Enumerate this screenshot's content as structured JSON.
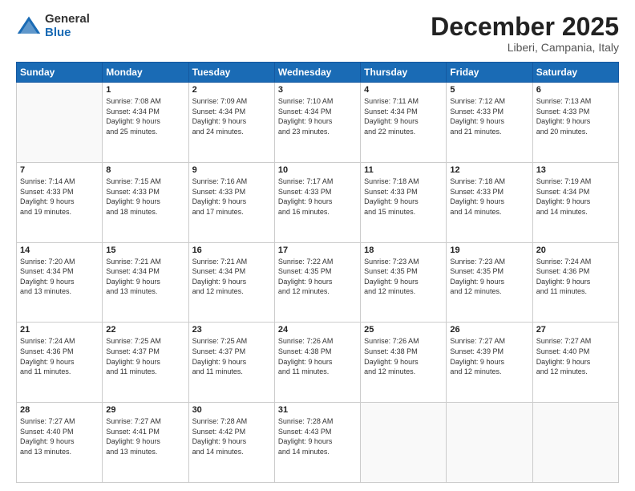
{
  "logo": {
    "general": "General",
    "blue": "Blue"
  },
  "title": "December 2025",
  "location": "Liberi, Campania, Italy",
  "weekdays": [
    "Sunday",
    "Monday",
    "Tuesday",
    "Wednesday",
    "Thursday",
    "Friday",
    "Saturday"
  ],
  "weeks": [
    [
      {
        "day": "",
        "info": ""
      },
      {
        "day": "1",
        "info": "Sunrise: 7:08 AM\nSunset: 4:34 PM\nDaylight: 9 hours\nand 25 minutes."
      },
      {
        "day": "2",
        "info": "Sunrise: 7:09 AM\nSunset: 4:34 PM\nDaylight: 9 hours\nand 24 minutes."
      },
      {
        "day": "3",
        "info": "Sunrise: 7:10 AM\nSunset: 4:34 PM\nDaylight: 9 hours\nand 23 minutes."
      },
      {
        "day": "4",
        "info": "Sunrise: 7:11 AM\nSunset: 4:34 PM\nDaylight: 9 hours\nand 22 minutes."
      },
      {
        "day": "5",
        "info": "Sunrise: 7:12 AM\nSunset: 4:33 PM\nDaylight: 9 hours\nand 21 minutes."
      },
      {
        "day": "6",
        "info": "Sunrise: 7:13 AM\nSunset: 4:33 PM\nDaylight: 9 hours\nand 20 minutes."
      }
    ],
    [
      {
        "day": "7",
        "info": "Sunrise: 7:14 AM\nSunset: 4:33 PM\nDaylight: 9 hours\nand 19 minutes."
      },
      {
        "day": "8",
        "info": "Sunrise: 7:15 AM\nSunset: 4:33 PM\nDaylight: 9 hours\nand 18 minutes."
      },
      {
        "day": "9",
        "info": "Sunrise: 7:16 AM\nSunset: 4:33 PM\nDaylight: 9 hours\nand 17 minutes."
      },
      {
        "day": "10",
        "info": "Sunrise: 7:17 AM\nSunset: 4:33 PM\nDaylight: 9 hours\nand 16 minutes."
      },
      {
        "day": "11",
        "info": "Sunrise: 7:18 AM\nSunset: 4:33 PM\nDaylight: 9 hours\nand 15 minutes."
      },
      {
        "day": "12",
        "info": "Sunrise: 7:18 AM\nSunset: 4:33 PM\nDaylight: 9 hours\nand 14 minutes."
      },
      {
        "day": "13",
        "info": "Sunrise: 7:19 AM\nSunset: 4:34 PM\nDaylight: 9 hours\nand 14 minutes."
      }
    ],
    [
      {
        "day": "14",
        "info": "Sunrise: 7:20 AM\nSunset: 4:34 PM\nDaylight: 9 hours\nand 13 minutes."
      },
      {
        "day": "15",
        "info": "Sunrise: 7:21 AM\nSunset: 4:34 PM\nDaylight: 9 hours\nand 13 minutes."
      },
      {
        "day": "16",
        "info": "Sunrise: 7:21 AM\nSunset: 4:34 PM\nDaylight: 9 hours\nand 12 minutes."
      },
      {
        "day": "17",
        "info": "Sunrise: 7:22 AM\nSunset: 4:35 PM\nDaylight: 9 hours\nand 12 minutes."
      },
      {
        "day": "18",
        "info": "Sunrise: 7:23 AM\nSunset: 4:35 PM\nDaylight: 9 hours\nand 12 minutes."
      },
      {
        "day": "19",
        "info": "Sunrise: 7:23 AM\nSunset: 4:35 PM\nDaylight: 9 hours\nand 12 minutes."
      },
      {
        "day": "20",
        "info": "Sunrise: 7:24 AM\nSunset: 4:36 PM\nDaylight: 9 hours\nand 11 minutes."
      }
    ],
    [
      {
        "day": "21",
        "info": "Sunrise: 7:24 AM\nSunset: 4:36 PM\nDaylight: 9 hours\nand 11 minutes."
      },
      {
        "day": "22",
        "info": "Sunrise: 7:25 AM\nSunset: 4:37 PM\nDaylight: 9 hours\nand 11 minutes."
      },
      {
        "day": "23",
        "info": "Sunrise: 7:25 AM\nSunset: 4:37 PM\nDaylight: 9 hours\nand 11 minutes."
      },
      {
        "day": "24",
        "info": "Sunrise: 7:26 AM\nSunset: 4:38 PM\nDaylight: 9 hours\nand 11 minutes."
      },
      {
        "day": "25",
        "info": "Sunrise: 7:26 AM\nSunset: 4:38 PM\nDaylight: 9 hours\nand 12 minutes."
      },
      {
        "day": "26",
        "info": "Sunrise: 7:27 AM\nSunset: 4:39 PM\nDaylight: 9 hours\nand 12 minutes."
      },
      {
        "day": "27",
        "info": "Sunrise: 7:27 AM\nSunset: 4:40 PM\nDaylight: 9 hours\nand 12 minutes."
      }
    ],
    [
      {
        "day": "28",
        "info": "Sunrise: 7:27 AM\nSunset: 4:40 PM\nDaylight: 9 hours\nand 13 minutes."
      },
      {
        "day": "29",
        "info": "Sunrise: 7:27 AM\nSunset: 4:41 PM\nDaylight: 9 hours\nand 13 minutes."
      },
      {
        "day": "30",
        "info": "Sunrise: 7:28 AM\nSunset: 4:42 PM\nDaylight: 9 hours\nand 14 minutes."
      },
      {
        "day": "31",
        "info": "Sunrise: 7:28 AM\nSunset: 4:43 PM\nDaylight: 9 hours\nand 14 minutes."
      },
      {
        "day": "",
        "info": ""
      },
      {
        "day": "",
        "info": ""
      },
      {
        "day": "",
        "info": ""
      }
    ]
  ]
}
